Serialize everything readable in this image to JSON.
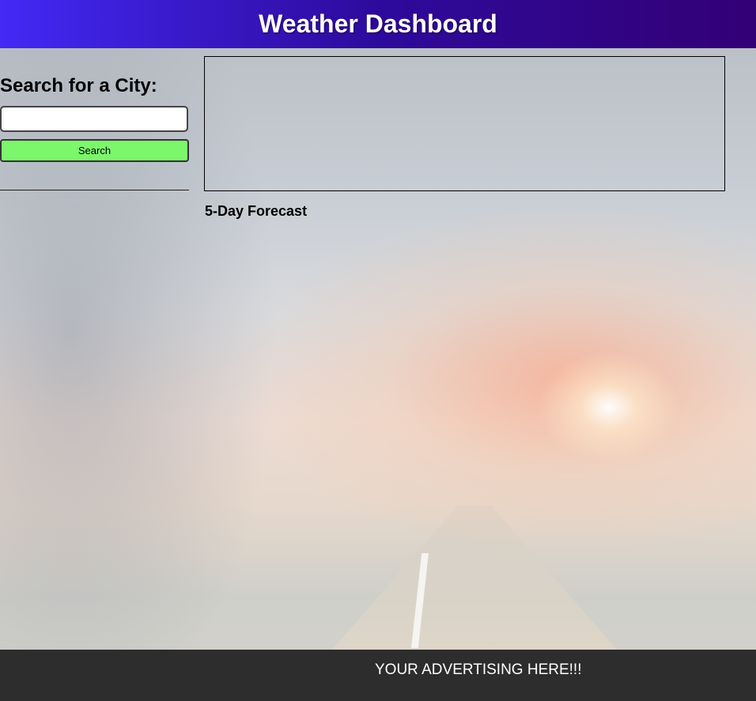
{
  "header": {
    "title": "Weather Dashboard"
  },
  "sidebar": {
    "heading": "Search for a City:",
    "search_value": "",
    "search_placeholder": "",
    "search_button_label": "Search",
    "history": []
  },
  "main": {
    "current_weather": {},
    "forecast_title": "5-Day Forecast",
    "forecast_days": []
  },
  "footer": {
    "text": "YOUR ADVERTISING HERE!!!"
  },
  "colors": {
    "header_start": "#4329f5",
    "header_end": "#330076",
    "search_button": "#7cf66b",
    "footer": "#2d2d2d"
  }
}
